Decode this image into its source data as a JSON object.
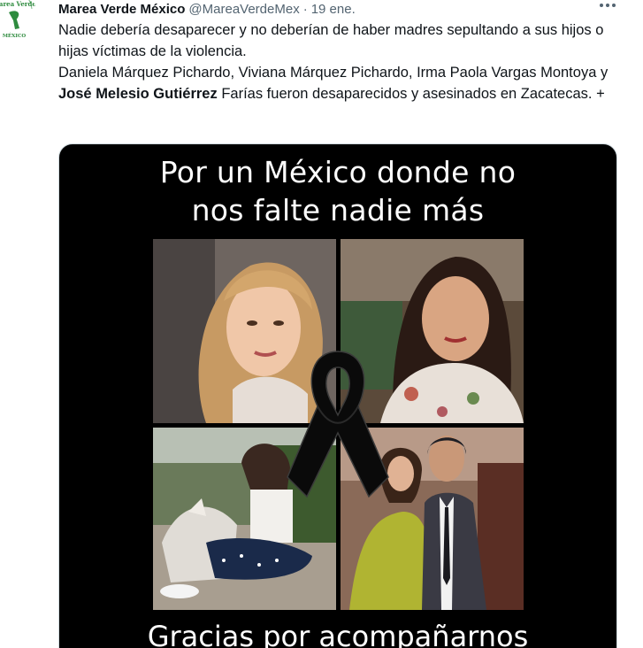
{
  "tweet": {
    "display_name": "Marea Verde México",
    "handle": "@MareaVerdeMex",
    "separator": "·",
    "date": "19 ene.",
    "avatar": {
      "logo_text": "Marea Verde",
      "logo_subtext": "MÉXICO",
      "icon": "green-scarf-logo-icon"
    },
    "more_icon": "more-options-icon",
    "text": {
      "line1": "Nadie debería desaparecer y no deberían de haber madres sepultando a sus hijos o hijas víctimas de la violencia.",
      "line2_pre": "Daniela Márquez Pichardo, Viviana Márquez Pichardo, Irma Paola Vargas Montoya y ",
      "line2_bold": "José Melesio Gutiérrez",
      "line2_post": " Farías fueron desaparecidos y asesinados en Zacatecas. +"
    },
    "media": {
      "title_line1": "Por un México donde no",
      "title_line2": "nos falte nadie más",
      "footer": "Gracias por acompañarnos",
      "ribbon_icon": "black-mourning-ribbon-icon"
    }
  },
  "colors": {
    "brand_green": "#2e8b3e",
    "text_primary": "#0f1419",
    "text_secondary": "#536471",
    "poster_bg": "#000000"
  }
}
